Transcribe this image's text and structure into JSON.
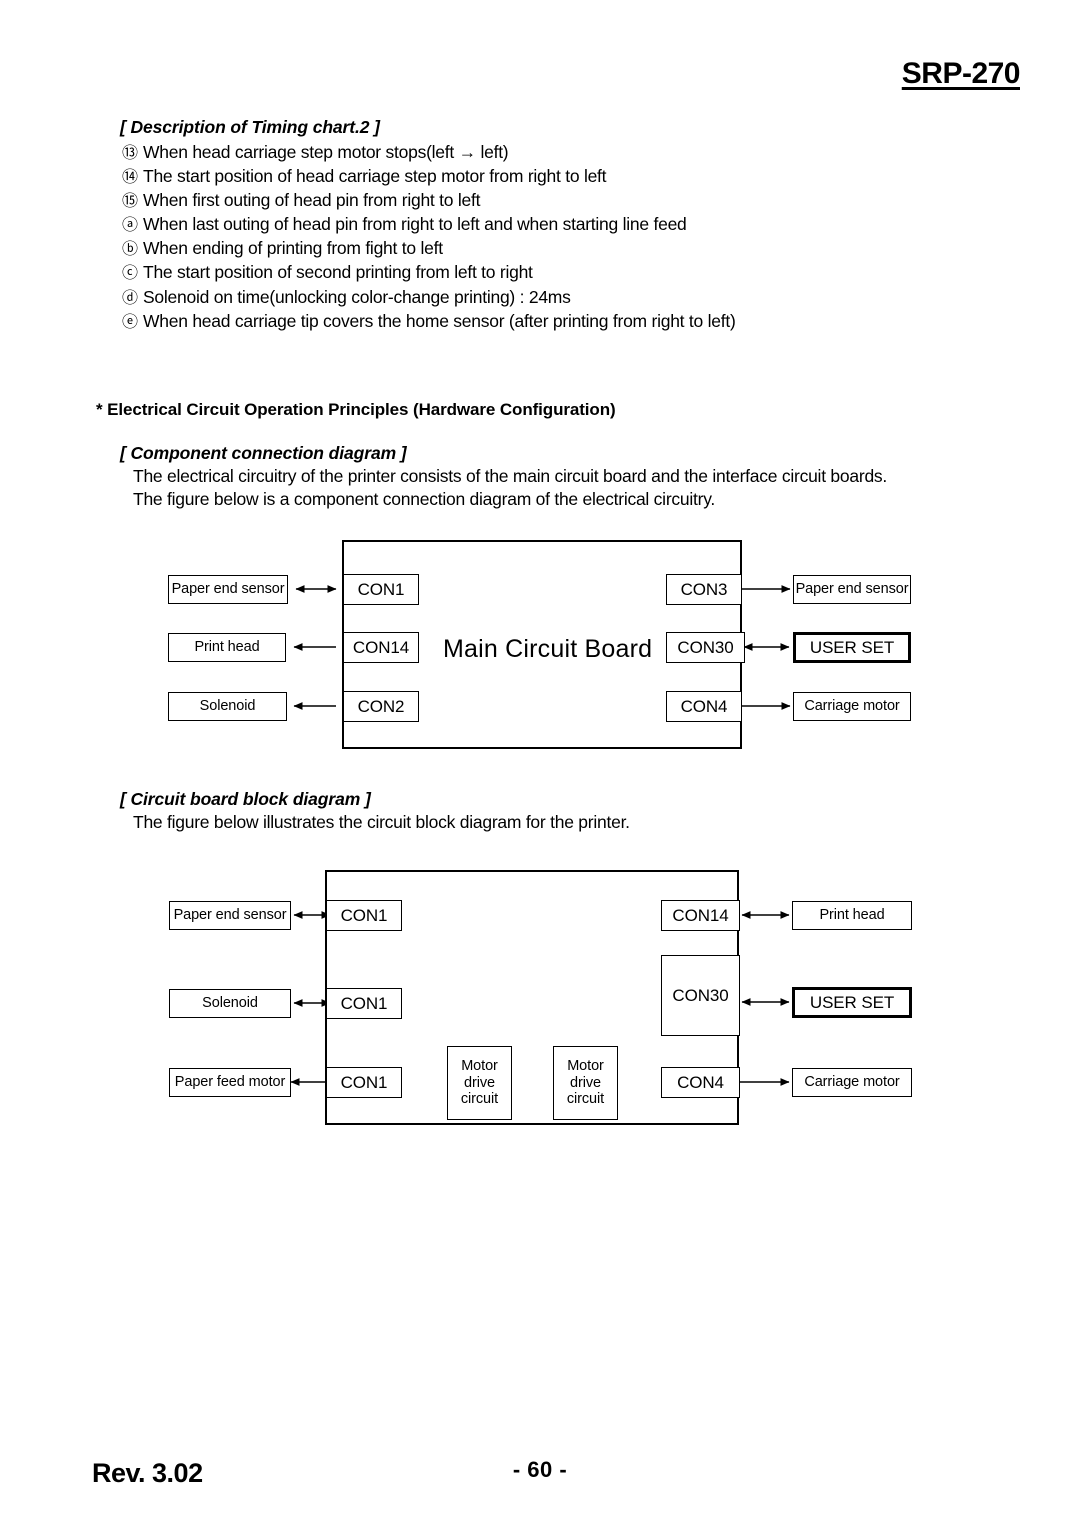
{
  "header": {
    "model": "SRP-270"
  },
  "timing_section": {
    "title": "[ Description of Timing chart.2 ]",
    "items": [
      {
        "marker": "⑬",
        "text": "When head carriage step motor stops(left → left)"
      },
      {
        "marker": "⑭",
        "text": "The start position of head carriage step motor from right to left"
      },
      {
        "marker": "⑮",
        "text": "When first outing of head pin from right to left"
      },
      {
        "marker": "ⓐ",
        "text": "When last outing of head pin from right to left and when starting line feed"
      },
      {
        "marker": "ⓑ",
        "text": "When ending of printing from fight to left"
      },
      {
        "marker": "ⓒ",
        "text": "The start position of second printing from left to right"
      },
      {
        "marker": "ⓓ",
        "text": "Solenoid on time(unlocking color-change printing) : 24ms"
      },
      {
        "marker": "ⓔ",
        "text": "When head carriage tip covers the home sensor (after printing from right to left)"
      }
    ]
  },
  "electrical_section": {
    "star_title": "* Electrical Circuit Operation Principles (Hardware Configuration)"
  },
  "component_section": {
    "title": "[ Component connection diagram ]",
    "line1": "The electrical circuitry of the printer consists of the main circuit board and the interface circuit boards.",
    "line2": "The figure below is a component connection diagram of the electrical circuitry."
  },
  "block_section": {
    "title": "[ Circuit board block diagram ]",
    "line1": "The figure below illustrates the circuit block diagram for the printer."
  },
  "diagram1": {
    "board_label": "Main Circuit Board",
    "left_connectors": [
      "CON1",
      "CON14",
      "CON2"
    ],
    "right_connectors": [
      "CON3",
      "CON30",
      "CON4"
    ],
    "left_components": [
      "Paper end sensor",
      "Print head",
      "Solenoid"
    ],
    "right_components": [
      "Paper end sensor",
      "USER SET",
      "Carriage motor"
    ]
  },
  "diagram2": {
    "left_connectors": [
      "CON1",
      "CON1",
      "CON1"
    ],
    "right_connectors": [
      "CON14",
      "CON30",
      "CON4"
    ],
    "left_components": [
      "Paper end sensor",
      "Solenoid",
      "Paper feed motor"
    ],
    "right_components": [
      "Print head",
      "USER SET",
      "Carriage motor"
    ],
    "motor_drive_1": [
      "Motor",
      "drive",
      "circuit"
    ],
    "motor_drive_2": [
      "Motor",
      "drive",
      "circuit"
    ]
  },
  "footer": {
    "revision": "Rev. 3.02",
    "page": "- 60 -"
  }
}
